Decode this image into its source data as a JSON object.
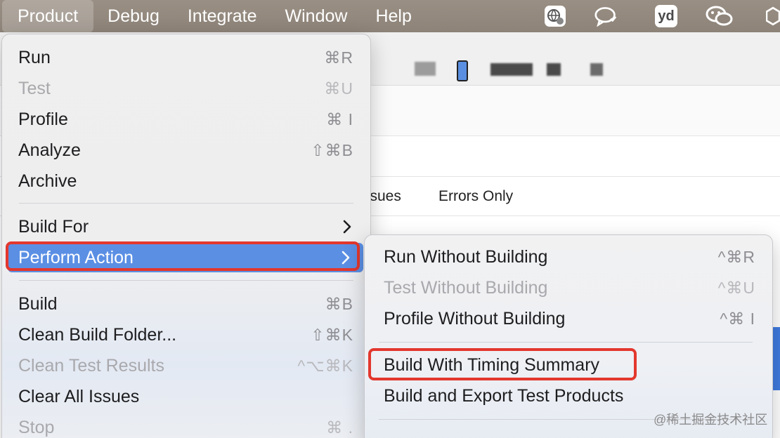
{
  "menubar": {
    "items": [
      "Product",
      "Debug",
      "Integrate",
      "Window",
      "Help"
    ],
    "tray_icons": [
      "globe-app-icon",
      "chat-bubble-icon",
      "youdao-icon",
      "wechat-icon",
      "hexagon-icon"
    ],
    "youdao_text": "yd"
  },
  "background": {
    "filter_tabs": [
      "ssues",
      "Errors Only"
    ]
  },
  "product_menu": {
    "items": [
      {
        "label": "Run",
        "shortcut": "⌘R",
        "enabled": true
      },
      {
        "label": "Test",
        "shortcut": "⌘U",
        "enabled": false
      },
      {
        "label": "Profile",
        "shortcut": "⌘ I",
        "enabled": true
      },
      {
        "label": "Analyze",
        "shortcut": "⇧⌘B",
        "enabled": true
      },
      {
        "label": "Archive",
        "shortcut": "",
        "enabled": true
      },
      {
        "label": "Build For",
        "shortcut": "",
        "enabled": true,
        "submenu": true
      },
      {
        "label": "Perform Action",
        "shortcut": "",
        "enabled": true,
        "submenu": true,
        "highlighted": true
      },
      {
        "label": "Build",
        "shortcut": "⌘B",
        "enabled": true
      },
      {
        "label": "Clean Build Folder...",
        "shortcut": "⇧⌘K",
        "enabled": true
      },
      {
        "label": "Clean Test Results",
        "shortcut": "^⌥⌘K",
        "enabled": false
      },
      {
        "label": "Clear All Issues",
        "shortcut": "",
        "enabled": true
      },
      {
        "label": "Stop",
        "shortcut": "⌘ .",
        "enabled": false
      }
    ]
  },
  "perform_action_menu": {
    "items": [
      {
        "label": "Run Without Building",
        "shortcut": "^⌘R",
        "enabled": true
      },
      {
        "label": "Test Without Building",
        "shortcut": "^⌘U",
        "enabled": false
      },
      {
        "label": "Profile Without Building",
        "shortcut": "^⌘ I",
        "enabled": true
      },
      {
        "label": "Build With Timing Summary",
        "shortcut": "",
        "enabled": true
      },
      {
        "label": "Build and Export Test Products",
        "shortcut": "",
        "enabled": true
      }
    ]
  },
  "watermark": "@稀土掘金技术社区",
  "colors": {
    "highlight": "#5b8fe4",
    "annotation_red": "#e3372d",
    "menubar": "#8f857a"
  }
}
